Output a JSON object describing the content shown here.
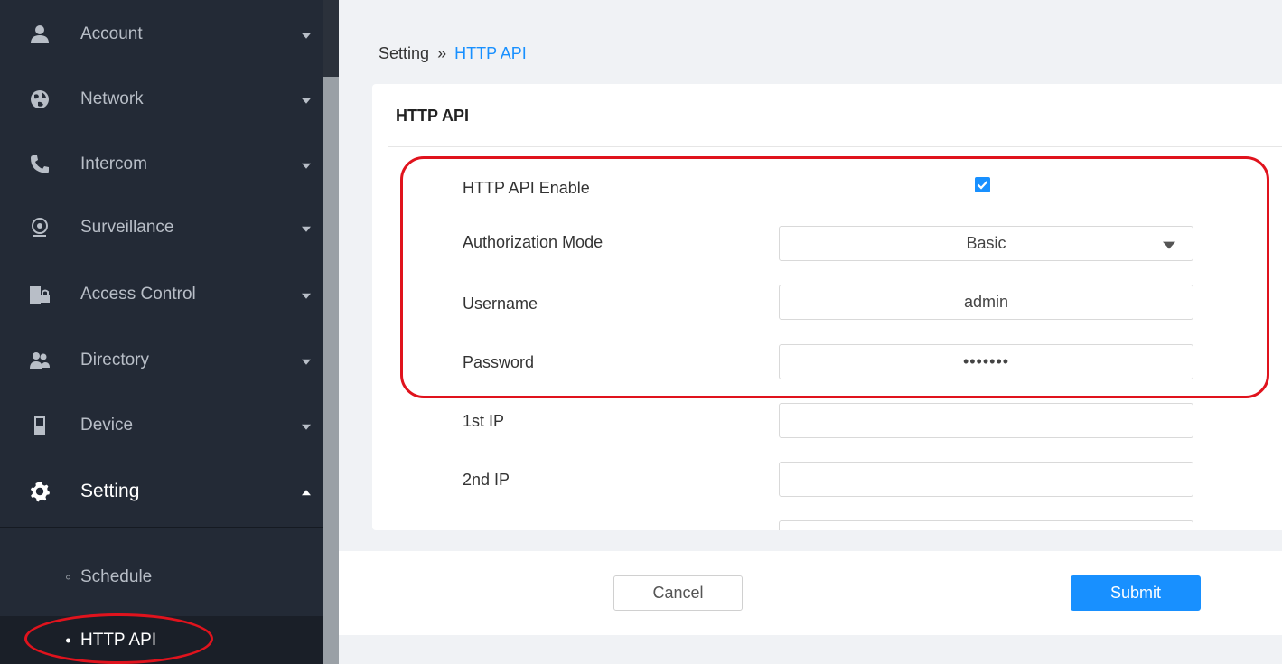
{
  "colors": {
    "sidebar_bg": "#232a36",
    "accent": "#1890ff",
    "highlight": "#e0131d"
  },
  "sidebar": {
    "items": [
      {
        "label": "Account",
        "icon": "user-icon"
      },
      {
        "label": "Network",
        "icon": "globe-icon"
      },
      {
        "label": "Intercom",
        "icon": "phone-icon"
      },
      {
        "label": "Surveillance",
        "icon": "webcam-icon"
      },
      {
        "label": "Access Control",
        "icon": "door-lock-icon"
      },
      {
        "label": "Directory",
        "icon": "users-icon"
      },
      {
        "label": "Device",
        "icon": "device-icon"
      },
      {
        "label": "Setting",
        "icon": "gear-icon",
        "expanded": true
      }
    ],
    "subitems": [
      {
        "label": "Schedule"
      },
      {
        "label": "HTTP API",
        "active": true
      }
    ]
  },
  "breadcrumb": {
    "parent": "Setting",
    "separator": "»",
    "current": "HTTP API"
  },
  "card": {
    "title": "HTTP API",
    "fields": {
      "enable": {
        "label": "HTTP API Enable",
        "checked": true
      },
      "auth_mode": {
        "label": "Authorization Mode",
        "value": "Basic"
      },
      "username": {
        "label": "Username",
        "value": "admin"
      },
      "password": {
        "label": "Password",
        "value": "•••••••"
      },
      "ip1": {
        "label": "1st IP",
        "value": ""
      },
      "ip2": {
        "label": "2nd IP",
        "value": ""
      }
    }
  },
  "footer": {
    "cancel_label": "Cancel",
    "submit_label": "Submit"
  }
}
